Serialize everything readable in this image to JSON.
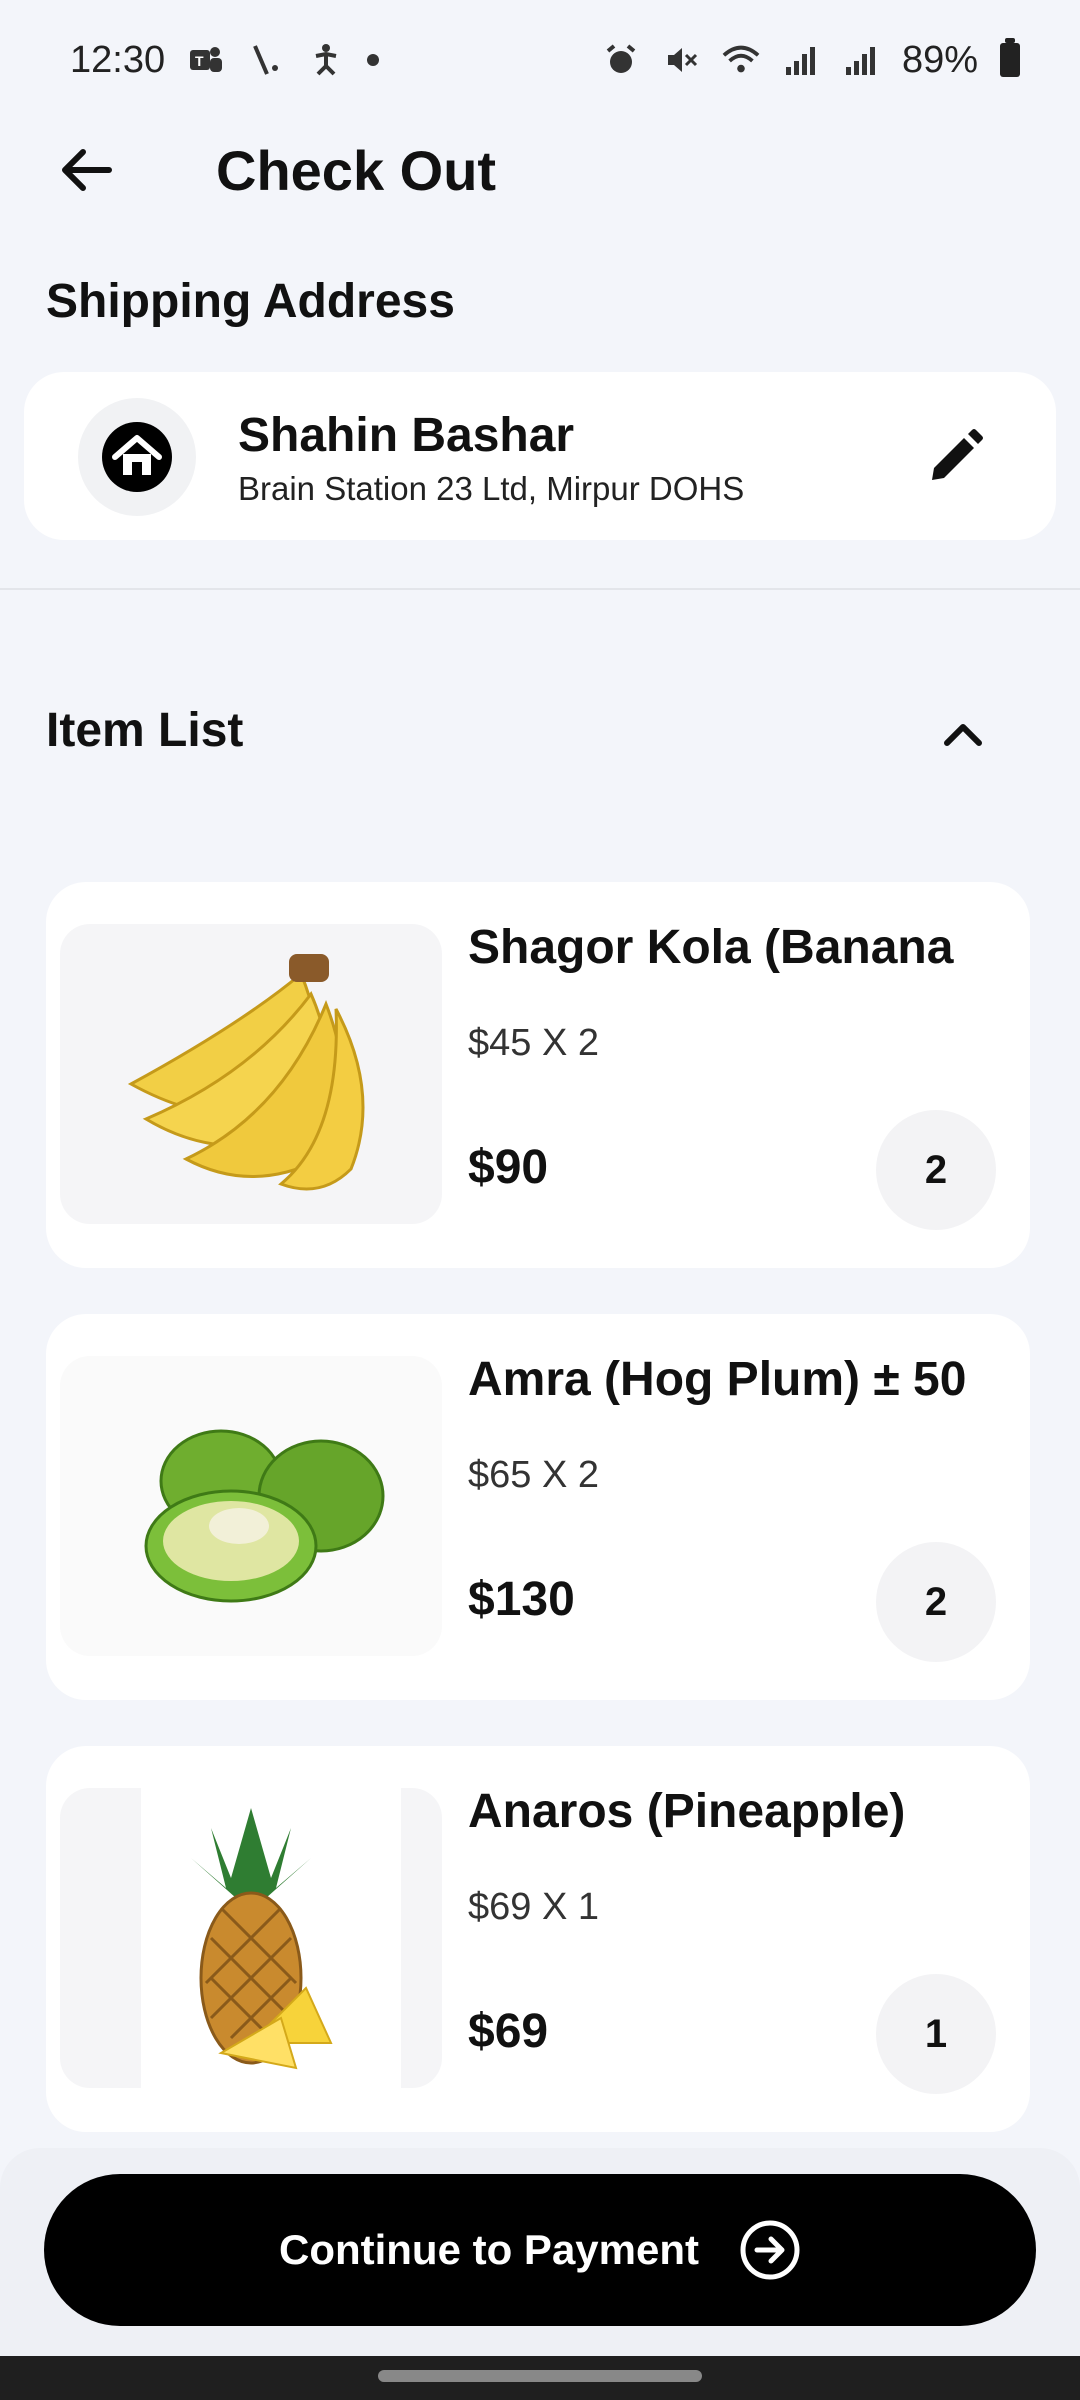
{
  "status_bar": {
    "time": "12:30",
    "battery": "89%",
    "left_icons": [
      "teams-icon",
      "slash-icon",
      "accessibility-icon",
      "dot-icon"
    ],
    "right_icons": [
      "alarm-icon",
      "mute-icon",
      "wifi-icon",
      "signal-icon",
      "signal-icon",
      "battery-icon"
    ]
  },
  "header": {
    "title": "Check Out"
  },
  "shipping": {
    "section_title": "Shipping Address",
    "name": "Shahin Bashar",
    "address": "Brain Station 23 Ltd, Mirpur DOHS"
  },
  "items_section": {
    "title": "Item List"
  },
  "items": [
    {
      "name": "Shagor Kola (Banana",
      "unit_price": "$45 X 2",
      "total": "$90",
      "quantity": "2",
      "image": "banana"
    },
    {
      "name": "Amra (Hog Plum) ± 50",
      "unit_price": "$65 X 2",
      "total": "$130",
      "quantity": "2",
      "image": "hog-plum"
    },
    {
      "name": "Anaros (Pineapple)",
      "unit_price": "$69 X 1",
      "total": "$69",
      "quantity": "1",
      "image": "pineapple"
    }
  ],
  "footer": {
    "button_label": "Continue to Payment"
  },
  "colors": {
    "background": "#f3f5fa",
    "card": "#ffffff",
    "primary_button": "#000000"
  }
}
